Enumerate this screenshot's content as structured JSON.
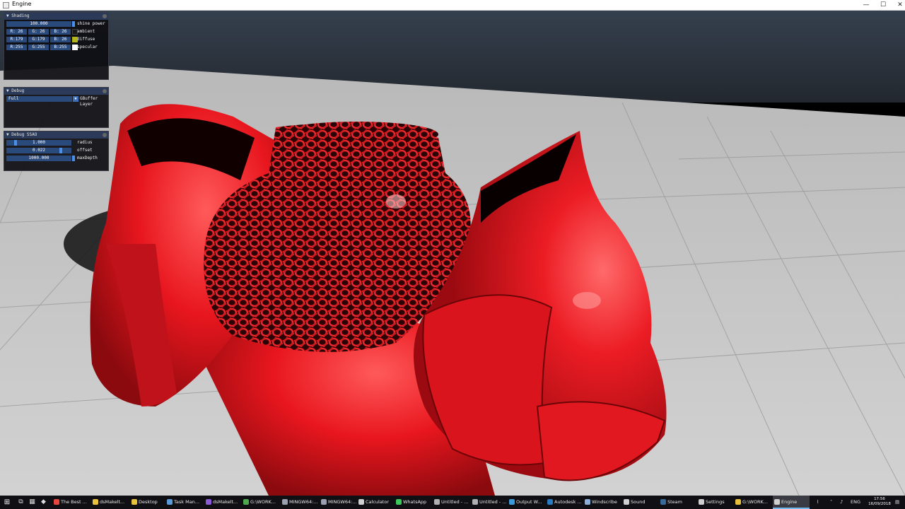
{
  "window": {
    "title": "Engine",
    "minimize": "—",
    "maximize": "☐",
    "close": "✕"
  },
  "panels": {
    "shading": {
      "title": "Shading",
      "shine_value": "100.000",
      "shine_label": "shine power",
      "ambient": {
        "r": "R: 26",
        "g": "G: 26",
        "b": "B: 26",
        "label": "ambient",
        "color": "#1a1a1a"
      },
      "diffuse": {
        "r": "R:179",
        "g": "G:179",
        "b": "B: 26",
        "label": "diffuse",
        "color": "#b3b31a"
      },
      "specular": {
        "r": "R:255",
        "g": "G:255",
        "b": "B:255",
        "label": "specular",
        "color": "#ffffff"
      }
    },
    "debug": {
      "title": "Debug",
      "layer_value": "Full",
      "layer_label": "GBuffer Layer"
    },
    "ssao": {
      "title": "Debug SSAO",
      "radius_value": "1.000",
      "radius_label": "radius",
      "offset_value": "0.022",
      "offset_label": "offset",
      "maxdepth_value": "1000.000",
      "maxdepth_label": "maxDepth"
    }
  },
  "taskbar": {
    "items": [
      {
        "label": "The Best ...",
        "color": "#e8453c"
      },
      {
        "label": "dsMakelt...",
        "color": "#e8c23c"
      },
      {
        "label": "Desktop",
        "color": "#e8c23c"
      },
      {
        "label": "Task Man...",
        "color": "#5a9ad8"
      },
      {
        "label": "dsMakelt...",
        "color": "#8a5ad8"
      },
      {
        "label": "G:\\WORK...",
        "color": "#4fa84f"
      },
      {
        "label": "MINGW64:...",
        "color": "#9aa0b0"
      },
      {
        "label": "MINGW64:...",
        "color": "#9aa0b0"
      },
      {
        "label": "Calculator",
        "color": "#cfcfcf"
      },
      {
        "label": "WhatsApp",
        "color": "#3cc85a"
      },
      {
        "label": "Untitled - ...",
        "color": "#b0b0b0"
      },
      {
        "label": "Untitled - ...",
        "color": "#b0b0b0"
      },
      {
        "label": "Output W...",
        "color": "#3c9ad8"
      },
      {
        "label": "Autodesk ...",
        "color": "#2a7ac0"
      },
      {
        "label": "Windscribe",
        "color": "#8ab0d8"
      },
      {
        "label": "Sound",
        "color": "#cfcfcf"
      },
      {
        "label": "Steam",
        "color": "#3a6a9a"
      },
      {
        "label": "Settings",
        "color": "#cfcfcf"
      },
      {
        "label": "G:\\WORK...",
        "color": "#e8c23c"
      },
      {
        "label": "Engine",
        "color": "#d0d0d0"
      }
    ],
    "tray_lang": "ENG",
    "time": "17:56",
    "date": "16/09/2018"
  }
}
